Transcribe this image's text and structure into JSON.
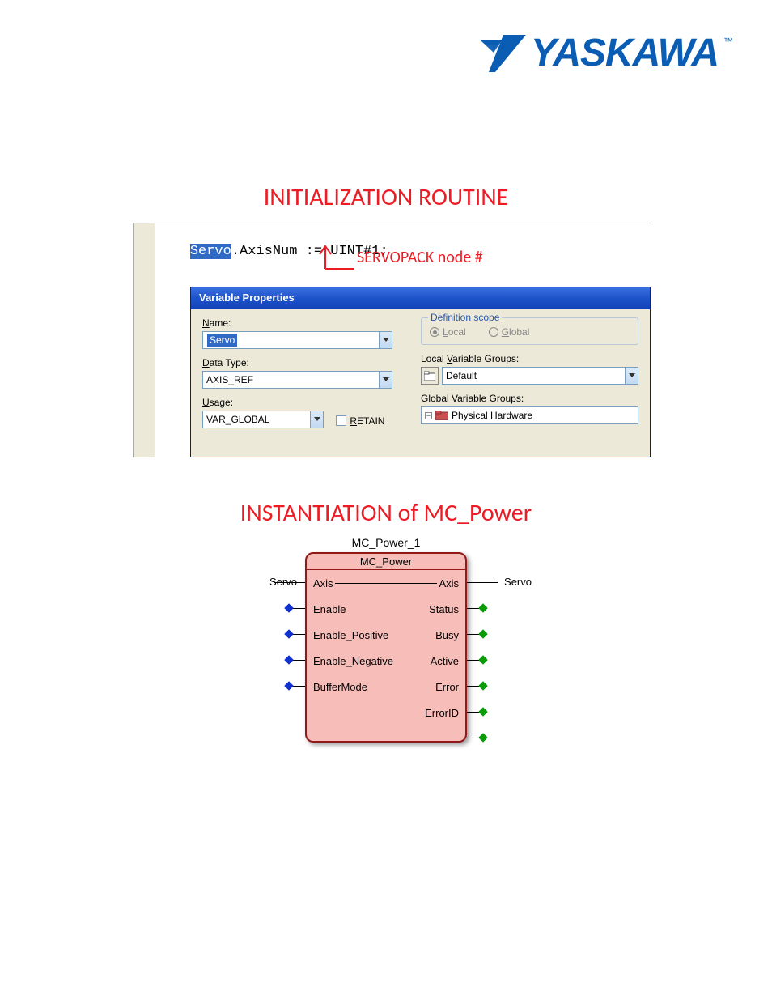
{
  "logo": {
    "text": "YASKAWA",
    "tm": "™"
  },
  "heading1": "INITIALIZATION ROUTINE",
  "heading2": "INSTANTIATION of MC_Power",
  "code": {
    "var": "Servo",
    "rest": ".AxisNum := UINT#1;"
  },
  "annotation": "SERVOPACK node #",
  "vp": {
    "title": "Variable Properties",
    "name_label": "Name:",
    "name_value": "Servo",
    "dtype_label": "Data Type:",
    "dtype_value": "AXIS_REF",
    "usage_label": "Usage:",
    "usage_value": "VAR_GLOBAL",
    "retain_label": "RETAIN",
    "defscope": "Definition scope",
    "local": "Local",
    "global": "Global",
    "lvg_label": "Local Variable Groups:",
    "lvg_value": "Default",
    "gvg_label": "Global Variable Groups:",
    "gvg_item": "Physical Hardware",
    "tree_symbol": "−"
  },
  "fb": {
    "instance": "MC_Power_1",
    "type": "MC_Power",
    "axis_in_ext": "Servo",
    "axis_out_ext": "Servo",
    "inputs": [
      "Axis",
      "Enable",
      "Enable_Positive",
      "Enable_Negative",
      "BufferMode"
    ],
    "outputs": [
      "Axis",
      "Status",
      "Busy",
      "Active",
      "Error",
      "ErrorID"
    ]
  }
}
